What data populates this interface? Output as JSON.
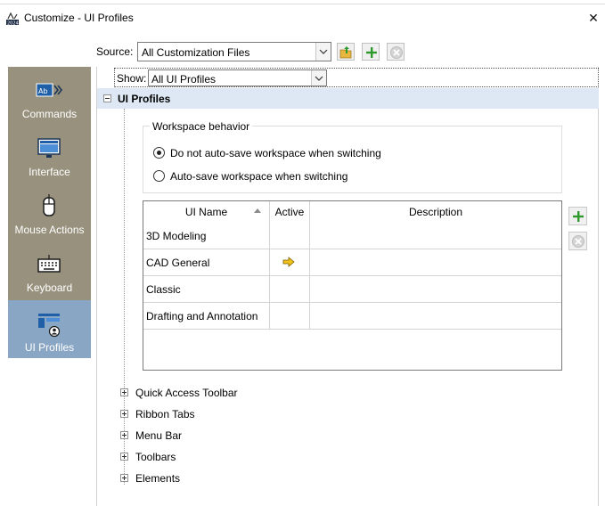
{
  "window": {
    "title": "Customize - UI Profiles",
    "close_glyph": "✕"
  },
  "source": {
    "label": "Source:",
    "value": "All Customization Files"
  },
  "nav": {
    "items": [
      {
        "label": "Commands",
        "icon": "commands-icon"
      },
      {
        "label": "Interface",
        "icon": "interface-icon"
      },
      {
        "label": "Mouse Actions",
        "icon": "mouse-icon"
      },
      {
        "label": "Keyboard",
        "icon": "keyboard-icon"
      },
      {
        "label": "UI Profiles",
        "icon": "ui-profiles-icon",
        "active": true
      }
    ]
  },
  "show": {
    "label": "Show:",
    "value": "All UI Profiles"
  },
  "ui_profiles": {
    "title": "UI Profiles",
    "workspace": {
      "legend": "Workspace behavior",
      "option_1": "Do not auto-save workspace when switching",
      "option_2": "Auto-save workspace when switching",
      "selected": 1
    },
    "table": {
      "columns": [
        "UI Name",
        "Active",
        "Description"
      ],
      "rows": [
        {
          "name": "3D Modeling",
          "active": false
        },
        {
          "name": "CAD General",
          "active": true
        },
        {
          "name": "Classic",
          "active": false
        },
        {
          "name": "Drafting and Annotation",
          "active": false
        }
      ]
    }
  },
  "tree": {
    "items": [
      "Quick Access Toolbar",
      "Ribbon Tabs",
      "Menu Bar",
      "Toolbars",
      "Elements"
    ]
  },
  "colors": {
    "nav_bg": "#97917d",
    "nav_active": "#89a6c4",
    "header_bg": "#dde8f4",
    "add_green": "#2e9a2e",
    "active_arrow": "#f1c21b"
  }
}
